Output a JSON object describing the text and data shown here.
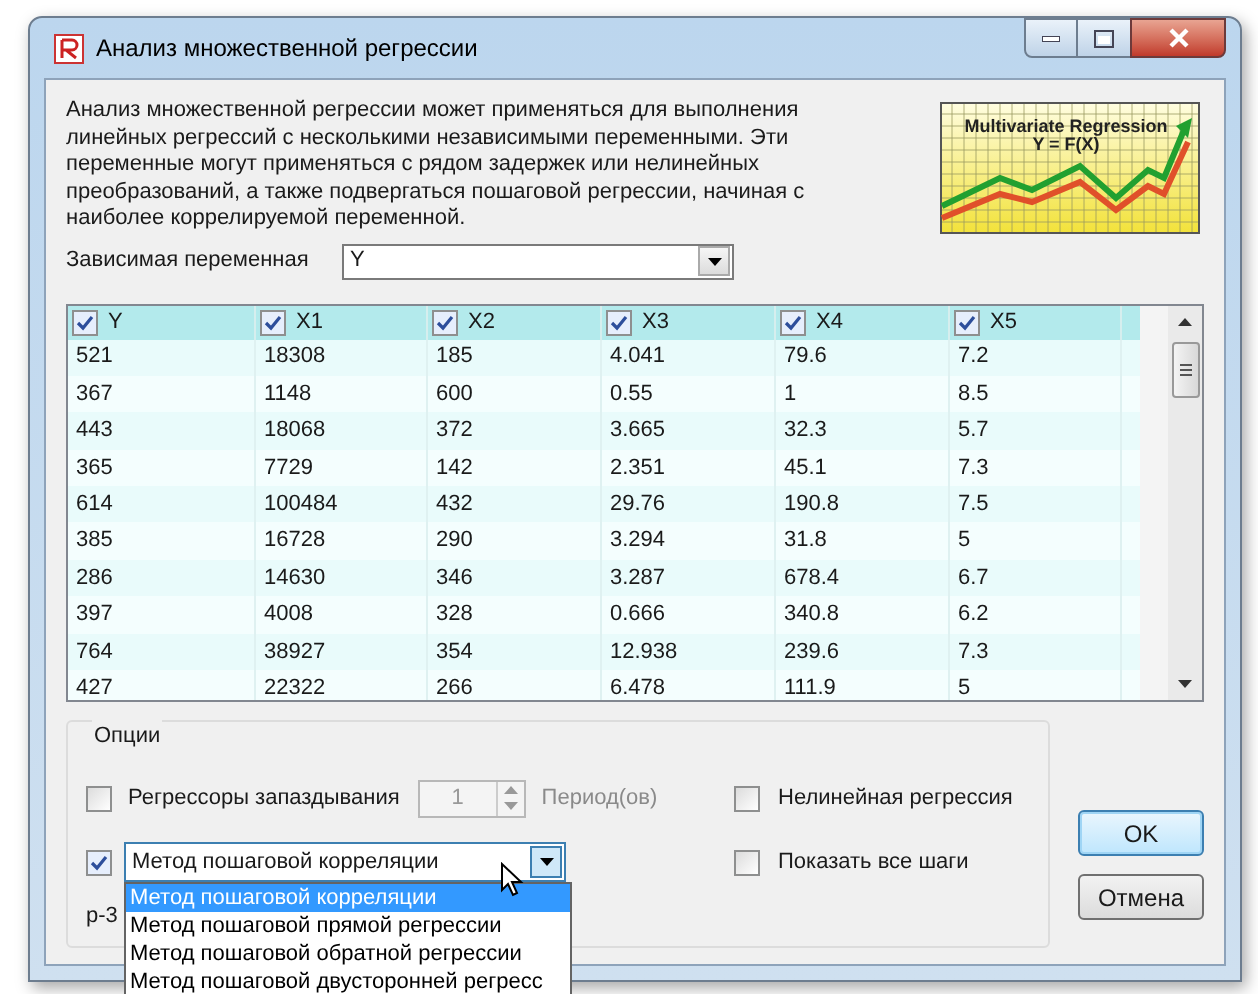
{
  "window": {
    "title": "Анализ множественной регрессии"
  },
  "description": "Анализ множественной регрессии может применяться для выполнения линейных регрессий с несколькими независимыми переменными. Эти переменные могут применяться с рядом задержек или нелинейных преобразований, а также подвергаться пошаговой регрессии, начиная с наиболее коррелируемой переменной.",
  "illustration": {
    "caption": [
      "Multivariate Regression",
      "Y = F(X)"
    ]
  },
  "dependent_variable": {
    "label": "Зависимая переменная",
    "value": "Y"
  },
  "table": {
    "columns": [
      {
        "label": "Y",
        "checked": true
      },
      {
        "label": "X1",
        "checked": true
      },
      {
        "label": "X2",
        "checked": true
      },
      {
        "label": "X3",
        "checked": true
      },
      {
        "label": "X4",
        "checked": true
      },
      {
        "label": "X5",
        "checked": true
      }
    ],
    "rows": [
      [
        "521",
        "18308",
        "185",
        "4.041",
        "79.6",
        "7.2"
      ],
      [
        "367",
        "1148",
        "600",
        "0.55",
        "1",
        "8.5"
      ],
      [
        "443",
        "18068",
        "372",
        "3.665",
        "32.3",
        "5.7"
      ],
      [
        "365",
        "7729",
        "142",
        "2.351",
        "45.1",
        "7.3"
      ],
      [
        "614",
        "100484",
        "432",
        "29.76",
        "190.8",
        "7.5"
      ],
      [
        "385",
        "16728",
        "290",
        "3.294",
        "31.8",
        "5"
      ],
      [
        "286",
        "14630",
        "346",
        "3.287",
        "678.4",
        "6.7"
      ],
      [
        "397",
        "4008",
        "328",
        "0.666",
        "340.8",
        "6.2"
      ],
      [
        "764",
        "38927",
        "354",
        "12.938",
        "239.6",
        "7.3"
      ],
      [
        "427",
        "22322",
        "266",
        "6.478",
        "111.9",
        "5"
      ]
    ]
  },
  "options": {
    "title": "Опции",
    "lag_regressors": {
      "label": "Регрессоры запаздывания",
      "checked": false,
      "value": "1",
      "unit": "Период(ов)"
    },
    "nonlinear": {
      "label": "Нелинейная регрессия",
      "checked": false
    },
    "stepwise": {
      "checked": true,
      "value": "Метод пошаговой корреляции",
      "expanded": true,
      "items": [
        {
          "label": "Метод пошаговой корреляции",
          "selected": true
        },
        {
          "label": "Метод пошаговой прямой регрессии",
          "selected": false
        },
        {
          "label": "Метод пошаговой обратной регрессии",
          "selected": false
        },
        {
          "label": "Метод пошаговой двусторонней регресс",
          "selected": false
        }
      ]
    },
    "show_all_steps": {
      "label": "Показать все шаги",
      "checked": false
    },
    "partial_label": "р-3"
  },
  "buttons": [
    {
      "label": "OK",
      "default": true
    },
    {
      "label": "Отмена",
      "default": false
    }
  ]
}
